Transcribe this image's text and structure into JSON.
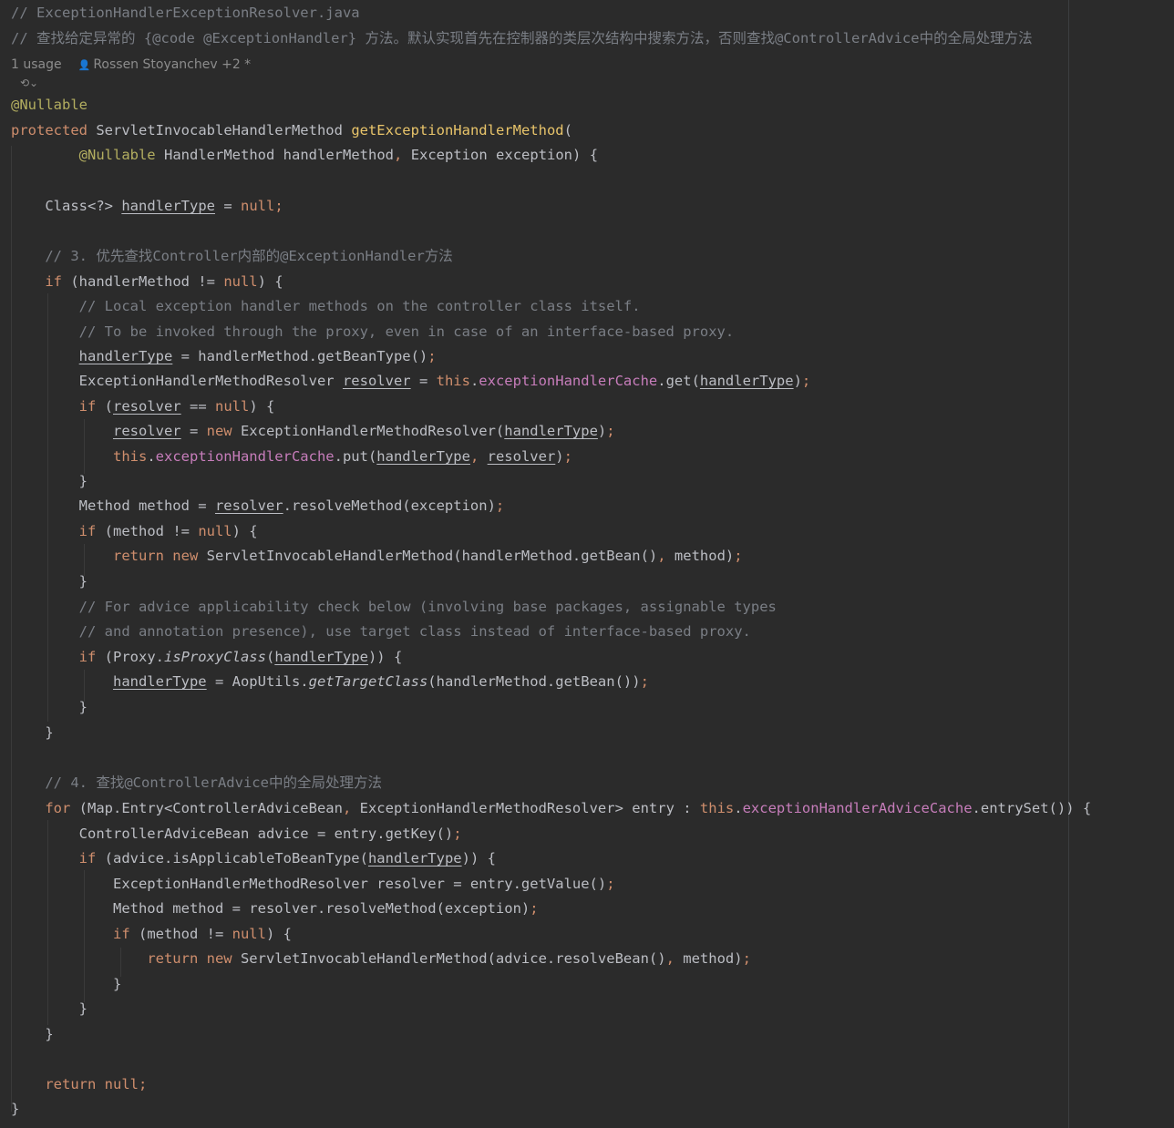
{
  "file_comment": "// ExceptionHandlerExceptionResolver.java",
  "doc_comment": "// 查找给定异常的 {@code @ExceptionHandler} 方法。默认实现首先在控制器的类层次结构中搜索方法，否则查找@ControllerAdvice中的全局处理方法",
  "inlay": {
    "usages": "1 usage",
    "author": "Rossen Stoyanchev +2 *"
  },
  "colors": {
    "background": "#2b2b2b",
    "keyword": "#cf8e6d",
    "comment": "#7a7e85",
    "annotation": "#b3ae60",
    "field": "#c77dbb",
    "method_decl": "#e8c46a",
    "text": "#bcbec4"
  },
  "code": {
    "nullable": "@Nullable",
    "kw_protected": "protected",
    "return_type": "ServletInvocableHandlerMethod",
    "method_name": "getExceptionHandlerMethod",
    "params_type1": "HandlerMethod",
    "params_name1": "handlerMethod",
    "params_type2": "Exception",
    "params_name2": "exception",
    "comment_step3": "// 3. 优先查找Controller内部的@ExceptionHandler方法",
    "comment_local1": "// Local exception handler methods on the controller class itself.",
    "comment_local2": "// To be invoked through the proxy, even in case of an interface-based proxy.",
    "comment_advice1": "// For advice applicability check below (involving base packages, assignable types",
    "comment_advice2": "// and annotation presence), use target class instead of interface-based proxy.",
    "comment_step4": "// 4. 查找@ControllerAdvice中的全局处理方法"
  }
}
